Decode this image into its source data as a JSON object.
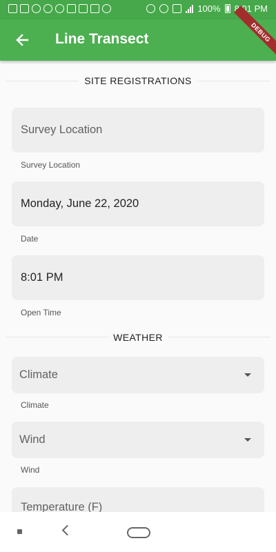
{
  "status_bar": {
    "battery_text": "100%",
    "time": "8:01 PM"
  },
  "app_bar": {
    "title": "Line Transect",
    "back_icon": "arrow-back-icon",
    "debug_label": "DEBUG"
  },
  "sections": {
    "site": {
      "title": "SITE REGISTRATIONS",
      "survey_location": {
        "placeholder": "Survey Location",
        "helper": "Survey Location"
      },
      "date": {
        "value": "Monday, June 22, 2020",
        "helper": "Date"
      },
      "open_time": {
        "value": "8:01 PM",
        "helper": "Open Time"
      }
    },
    "weather": {
      "title": "WEATHER",
      "climate": {
        "placeholder": "Climate",
        "helper": "Climate"
      },
      "wind": {
        "placeholder": "Wind",
        "helper": "Wind"
      },
      "temperature": {
        "placeholder": "Temperature (F)"
      }
    }
  },
  "colors": {
    "status_bar": "#46a84a",
    "app_bar": "#4caf50",
    "field_bg": "#eeeeee",
    "debug_banner": "#a32d2d"
  }
}
